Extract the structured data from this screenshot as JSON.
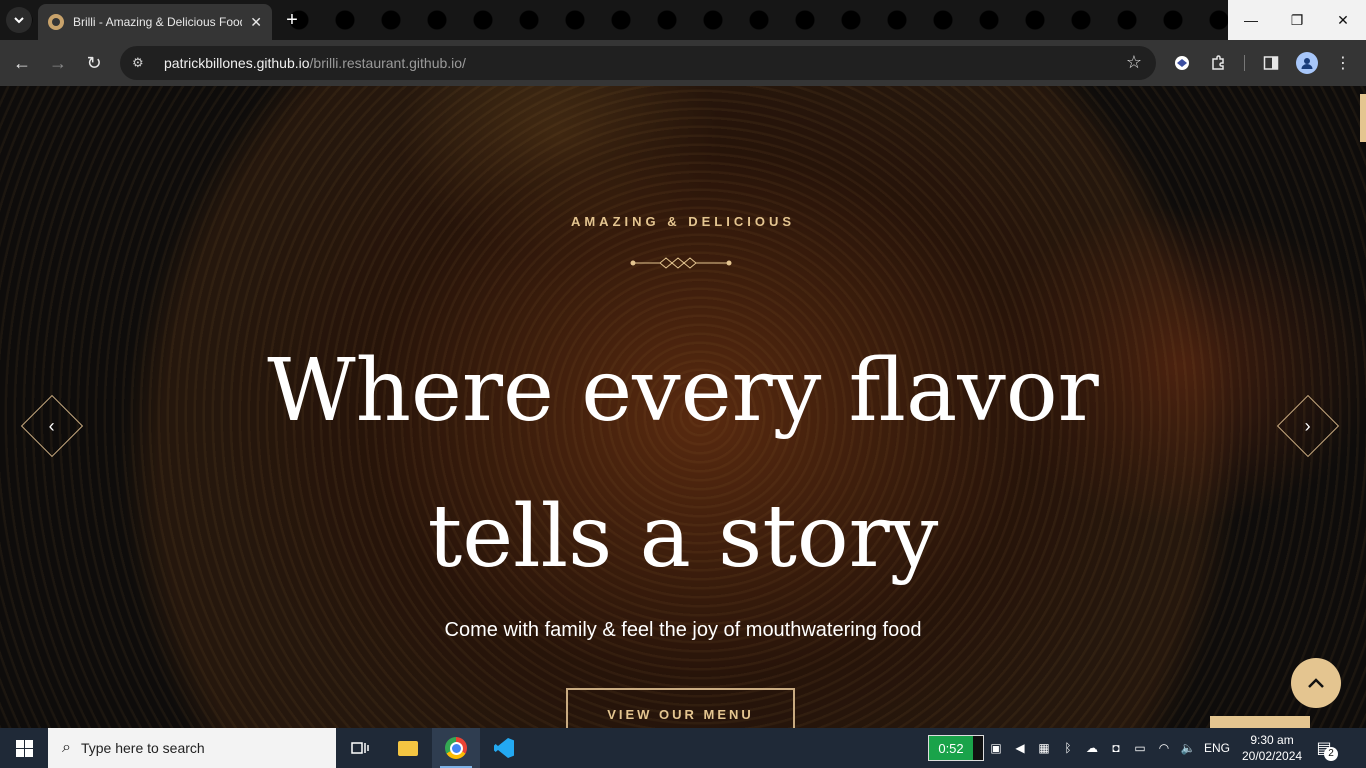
{
  "browser": {
    "tab": {
      "title": "Brilli - Amazing & Delicious Food"
    },
    "url": {
      "host": "patrickbillones.github.io",
      "path": "/brilli.restaurant.github.io/"
    }
  },
  "hero": {
    "subtitle": "AMAZING & DELICIOUS",
    "headline_line1": "Where every flavor",
    "headline_line2": "tells a story",
    "tagline": "Come with family & feel the joy of mouthwatering food",
    "cta_label": "VIEW OUR MENU"
  },
  "taskbar": {
    "search_placeholder": "Type here to search",
    "battery_timer": "0:52",
    "language": "ENG",
    "time": "9:30 am",
    "date": "20/02/2024",
    "notification_count": "2"
  },
  "colors": {
    "accent_gold": "#e4c590",
    "border_gold": "#c9ab81",
    "browser_dark": "#353535",
    "taskbar": "#1f2937"
  },
  "icons": {
    "tab_search": "chevron-down-icon",
    "favicon": "brilli-favicon-icon",
    "back": "back-arrow-icon",
    "forward": "forward-arrow-icon",
    "reload": "reload-icon",
    "site_info": "tune-icon",
    "bookmark": "star-icon",
    "extension": "puzzle-icon",
    "side_panel": "side-panel-icon",
    "profile": "profile-icon",
    "menu": "kebab-menu-icon",
    "prev": "chevron-left-icon",
    "next": "chevron-right-icon",
    "back_to_top": "chevron-up-icon"
  }
}
